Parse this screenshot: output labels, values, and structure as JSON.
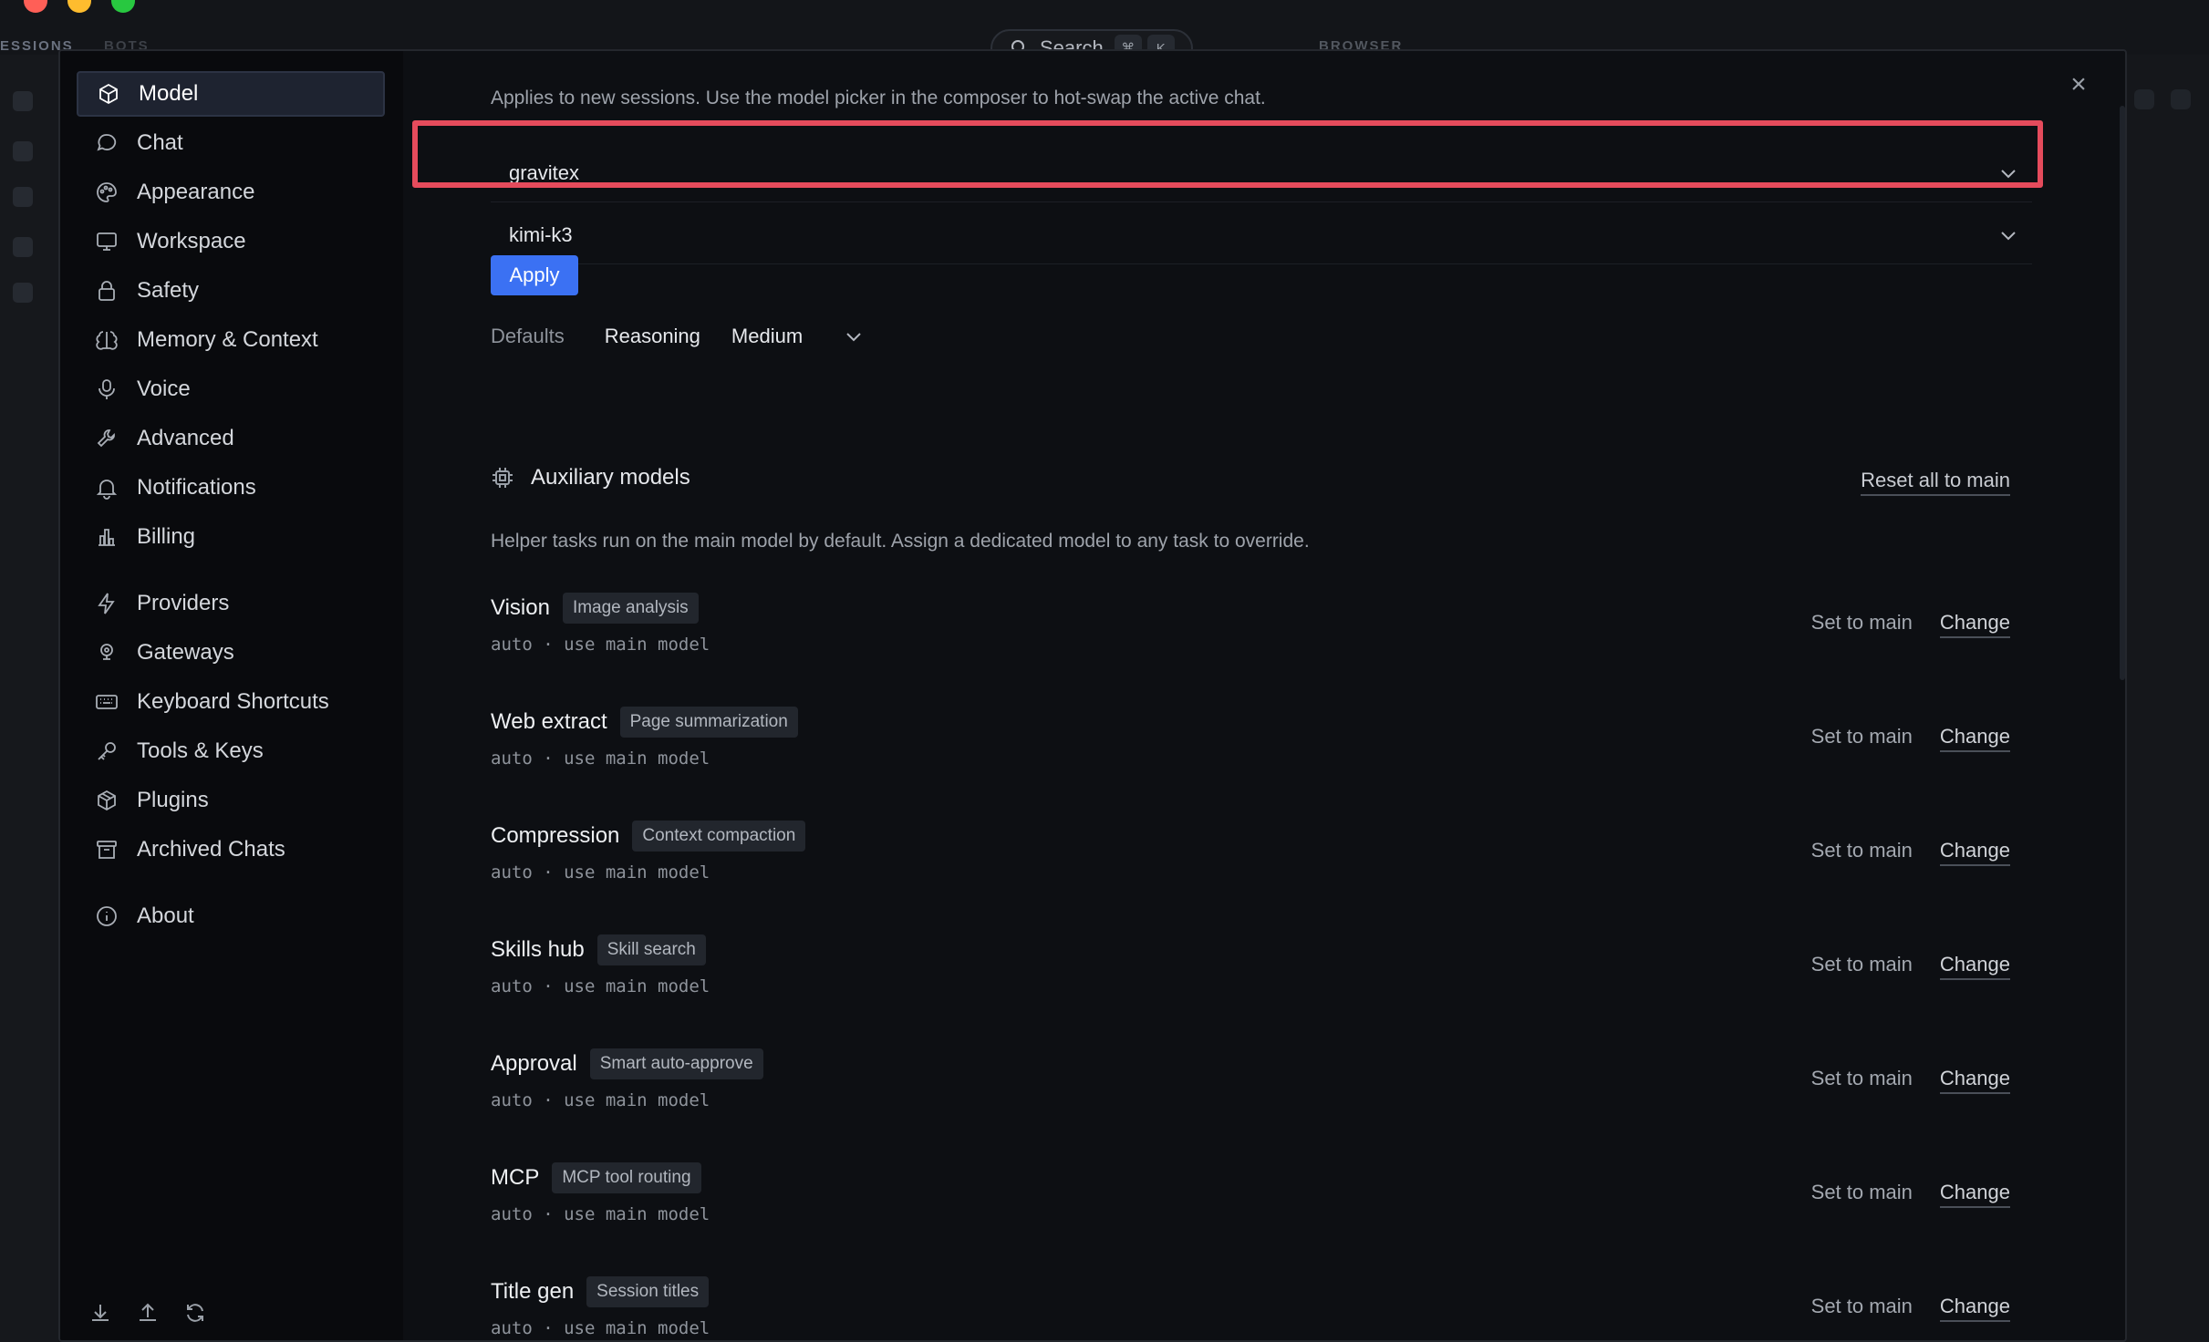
{
  "search": {
    "label": "Search",
    "key1": "⌘",
    "key2": "K"
  },
  "bg": {
    "tab1": "ESSIONS",
    "tab2": "BOTS",
    "browser": "BROWSER"
  },
  "sidebar": {
    "items": [
      {
        "label": "Model",
        "icon": "cube-icon"
      },
      {
        "label": "Chat",
        "icon": "chat-bubble-icon"
      },
      {
        "label": "Appearance",
        "icon": "palette-icon"
      },
      {
        "label": "Workspace",
        "icon": "monitor-icon"
      },
      {
        "label": "Safety",
        "icon": "lock-icon"
      },
      {
        "label": "Memory & Context",
        "icon": "brain-icon"
      },
      {
        "label": "Voice",
        "icon": "microphone-icon"
      },
      {
        "label": "Advanced",
        "icon": "wrench-icon"
      },
      {
        "label": "Notifications",
        "icon": "bell-icon"
      },
      {
        "label": "Billing",
        "icon": "bar-chart-icon"
      },
      {
        "label": "Providers",
        "icon": "lightning-icon"
      },
      {
        "label": "Gateways",
        "icon": "pin-icon"
      },
      {
        "label": "Keyboard Shortcuts",
        "icon": "keyboard-icon"
      },
      {
        "label": "Tools & Keys",
        "icon": "key-icon"
      },
      {
        "label": "Plugins",
        "icon": "package-icon"
      },
      {
        "label": "Archived Chats",
        "icon": "archive-icon"
      },
      {
        "label": "About",
        "icon": "info-icon"
      }
    ]
  },
  "model": {
    "description": "Applies to new sessions. Use the model picker in the composer to hot-swap the active chat.",
    "provider_value": "gravitex",
    "model_value": "kimi-k3",
    "apply_label": "Apply",
    "defaults_label": "Defaults",
    "reasoning_label": "Reasoning",
    "reasoning_value": "Medium"
  },
  "aux": {
    "title": "Auxiliary models",
    "reset_label": "Reset all to main",
    "description": "Helper tasks run on the main model by default. Assign a dedicated model to any task to override.",
    "set_label": "Set to main",
    "change_label": "Change",
    "rows": [
      {
        "name": "Vision",
        "tag": "Image analysis",
        "status": "auto · use main model"
      },
      {
        "name": "Web extract",
        "tag": "Page summarization",
        "status": "auto · use main model"
      },
      {
        "name": "Compression",
        "tag": "Context compaction",
        "status": "auto · use main model"
      },
      {
        "name": "Skills hub",
        "tag": "Skill search",
        "status": "auto · use main model"
      },
      {
        "name": "Approval",
        "tag": "Smart auto-approve",
        "status": "auto · use main model"
      },
      {
        "name": "MCP",
        "tag": "MCP tool routing",
        "status": "auto · use main model"
      },
      {
        "name": "Title gen",
        "tag": "Session titles",
        "status": "auto · use main model"
      }
    ]
  },
  "colors": {
    "accent": "#3b71f3",
    "highlight": "#e54b5c",
    "background": "#0d0f13"
  }
}
